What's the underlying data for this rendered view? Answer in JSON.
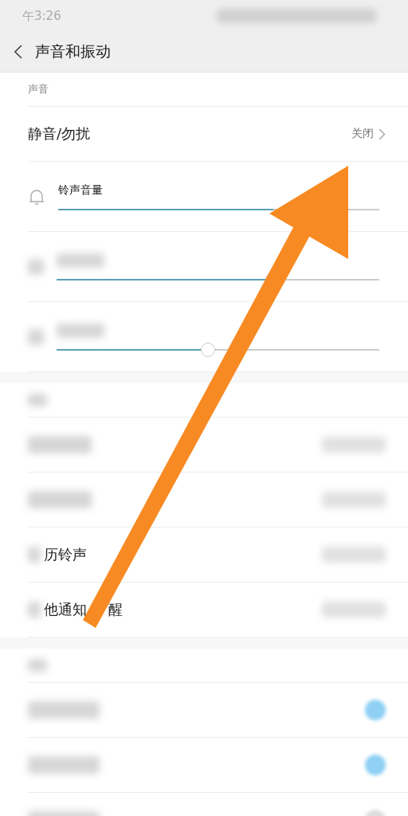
{
  "status_bar": {
    "time": "午3:26"
  },
  "header": {
    "title": "声音和振动"
  },
  "sound_section": {
    "label": "声音",
    "mute_row": {
      "label": "静音/勿扰",
      "value": "关闭"
    },
    "sliders": [
      {
        "kind": "named",
        "label": "铃声音量",
        "level": 0.67
      },
      {
        "kind": "blurred",
        "level": 0.67
      },
      {
        "kind": "blurred",
        "level": 0.47
      }
    ]
  },
  "second_section": {
    "rows": [
      {
        "kind": "blurred"
      },
      {
        "kind": "blurred"
      },
      {
        "kind": "text",
        "label": "历铃声"
      },
      {
        "kind": "text",
        "label": "他通知",
        "label_after_arrow": "醒"
      }
    ]
  },
  "third_section": {
    "rows": [
      {
        "kind": "toggle",
        "on": true
      },
      {
        "kind": "toggle",
        "on": true
      },
      {
        "kind": "toggle",
        "on": false
      }
    ]
  }
}
